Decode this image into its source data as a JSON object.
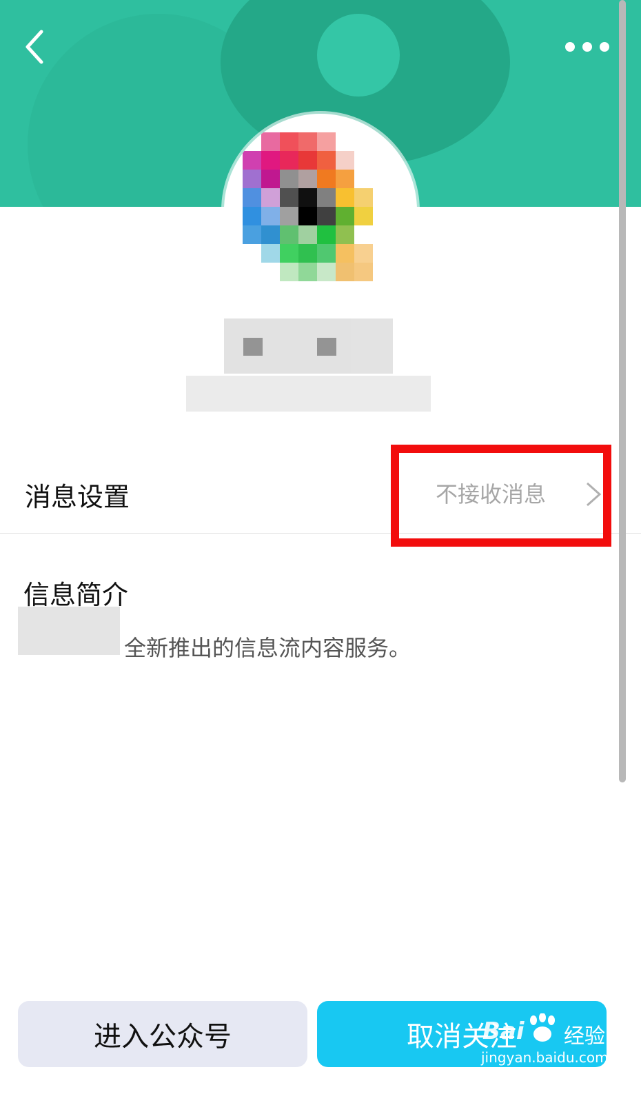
{
  "message_settings": {
    "label": "消息设置",
    "value": "不接收消息"
  },
  "intro": {
    "title": "信息简介",
    "text": "全新推出的信息流内容服务。"
  },
  "buttons": {
    "enter": "进入公众号",
    "unfollow": "取消关注"
  },
  "watermark": {
    "logo": "Bai",
    "text": "经验",
    "url": "jingyan.baidu.com"
  },
  "colors": {
    "header": "#2fbf9f",
    "primary_button": "#18c8f2",
    "highlight": "#f20d0d"
  },
  "icons": [
    "back-icon",
    "more-icon",
    "chevron-right-icon"
  ]
}
